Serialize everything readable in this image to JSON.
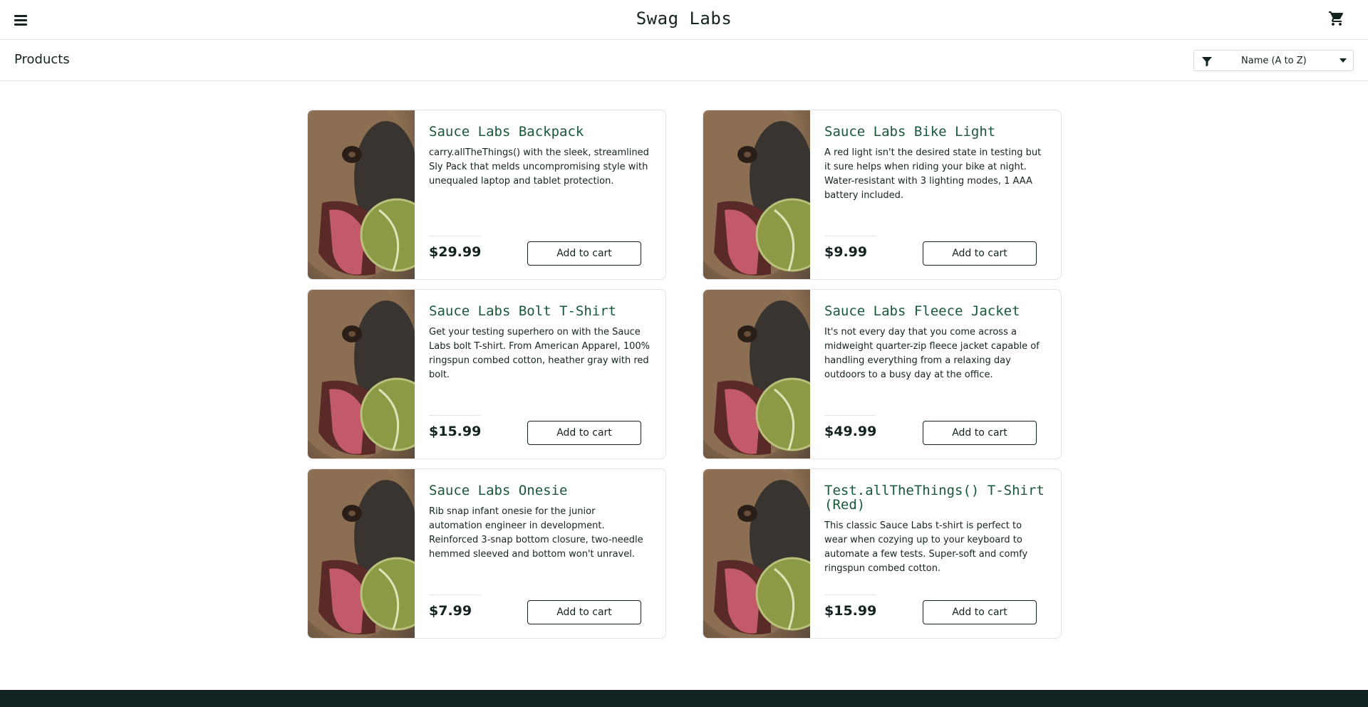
{
  "header": {
    "logo": "Swag Labs",
    "menu_icon": "hamburger-menu-icon",
    "cart_icon": "shopping-cart-icon"
  },
  "subheader": {
    "title": "Products",
    "sort": {
      "selected": "Name (A to Z)",
      "icon": "filter-icon"
    }
  },
  "products": [
    {
      "name": "Sauce Labs Backpack",
      "description": "carry.allTheThings() with the sleek, streamlined Sly Pack that melds uncompromising style with unequaled laptop and tablet protection.",
      "price": "$29.99",
      "button": "Add to cart"
    },
    {
      "name": "Sauce Labs Bike Light",
      "description": "A red light isn't the desired state in testing but it sure helps when riding your bike at night. Water-resistant with 3 lighting modes, 1 AAA battery included.",
      "price": "$9.99",
      "button": "Add to cart"
    },
    {
      "name": "Sauce Labs Bolt T-Shirt",
      "description": "Get your testing superhero on with the Sauce Labs bolt T-shirt. From American Apparel, 100% ringspun combed cotton, heather gray with red bolt.",
      "price": "$15.99",
      "button": "Add to cart"
    },
    {
      "name": "Sauce Labs Fleece Jacket",
      "description": "It's not every day that you come across a midweight quarter-zip fleece jacket capable of handling everything from a relaxing day outdoors to a busy day at the office.",
      "price": "$49.99",
      "button": "Add to cart"
    },
    {
      "name": "Sauce Labs Onesie",
      "description": "Rib snap infant onesie for the junior automation engineer in development. Reinforced 3-snap bottom closure, two-needle hemmed sleeved and bottom won't unravel.",
      "price": "$7.99",
      "button": "Add to cart"
    },
    {
      "name": "Test.allTheThings() T-Shirt (Red)",
      "description": "This classic Sauce Labs t-shirt is perfect to wear when cozying up to your keyboard to automate a few tests. Super-soft and comfy ringspun combed cotton.",
      "price": "$15.99",
      "button": "Add to cart"
    }
  ],
  "colors": {
    "accent": "#18583a",
    "text": "#132322",
    "border": "#e3e3e3",
    "footer": "#132322"
  }
}
